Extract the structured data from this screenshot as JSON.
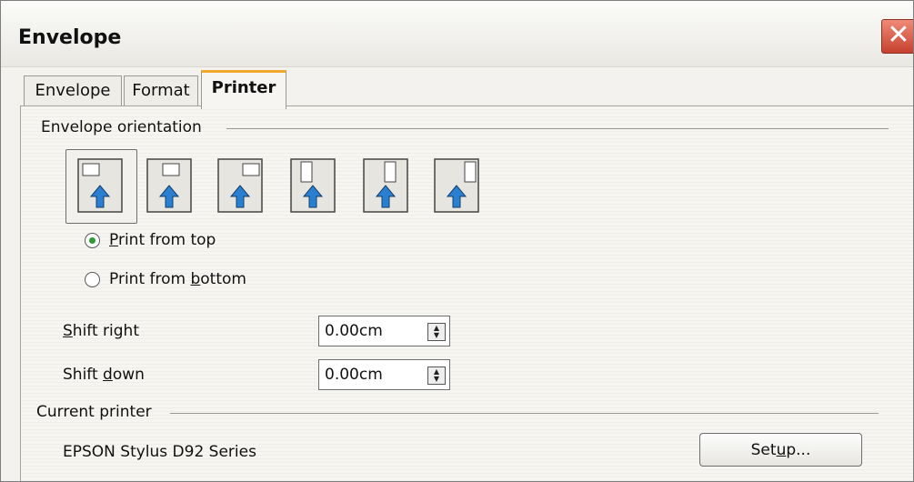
{
  "window": {
    "title": "Envelope",
    "close_glyph": "✕"
  },
  "tabs": [
    {
      "label": "Envelope",
      "active": false
    },
    {
      "label": "Format",
      "active": false
    },
    {
      "label": "Printer",
      "active": true
    }
  ],
  "orientation": {
    "section_label": "Envelope orientation",
    "options": [
      {
        "icon": "envelope-horizontal-left-icon",
        "selected": true
      },
      {
        "icon": "envelope-horizontal-center-icon",
        "selected": false
      },
      {
        "icon": "envelope-horizontal-right-icon",
        "selected": false
      },
      {
        "icon": "envelope-vertical-left-icon",
        "selected": false
      },
      {
        "icon": "envelope-vertical-center-icon",
        "selected": false
      },
      {
        "icon": "envelope-vertical-right-icon",
        "selected": false
      }
    ],
    "print_from_top": {
      "before": "",
      "mnemonic": "P",
      "after": "rint from top",
      "checked": true
    },
    "print_from_bottom": {
      "before": "Print from ",
      "mnemonic": "b",
      "after": "ottom",
      "checked": false
    }
  },
  "shift_right": {
    "before": "",
    "mnemonic": "S",
    "after": "hift right",
    "value": "0.00cm"
  },
  "shift_down": {
    "before": "Shift ",
    "mnemonic": "d",
    "after": "own",
    "value": "0.00cm"
  },
  "current_printer": {
    "section_label": "Current printer",
    "printer_name": "EPSON Stylus D92 Series",
    "setup_button": "Setup...",
    "setup_mnemonic_index": 3
  },
  "colors": {
    "accent_tab": "#f0a92c",
    "radio_checked": "#2f9a33",
    "icon_arrow": "#2b7fd0"
  }
}
